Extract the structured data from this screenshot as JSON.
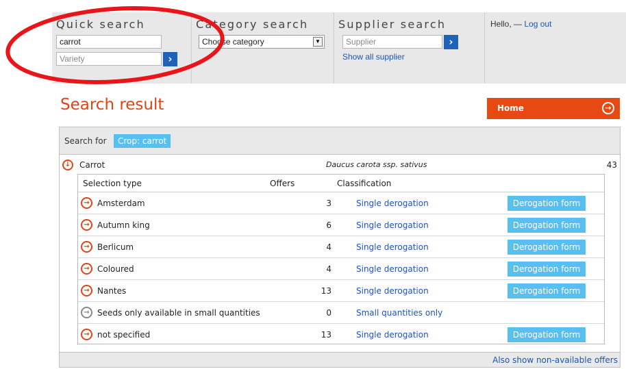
{
  "quick_search": {
    "title": "Quick search",
    "crop_value": "carrot",
    "variety_placeholder": "Variety",
    "go_label": "›"
  },
  "category_search": {
    "title": "Category search",
    "selected": "Choose category"
  },
  "supplier_search": {
    "title": "Supplier search",
    "placeholder": "Supplier",
    "go_label": "›",
    "show_all": "Show all supplier"
  },
  "user": {
    "hello": "Hello, —",
    "logout": "Log out"
  },
  "page": {
    "title": "Search result",
    "home_label": "Home"
  },
  "search_for": {
    "label": "Search for",
    "chip": "Crop: carrot"
  },
  "crop": {
    "name": "Carrot",
    "latin": "Daucus carota ssp. sativus",
    "count": "43"
  },
  "table": {
    "headers": {
      "selection": "Selection type",
      "offers": "Offers",
      "classification": "Classification"
    },
    "rows": [
      {
        "name": "Amsterdam",
        "offers": "3",
        "classification": "Single derogation",
        "form": "Derogation form",
        "icon": "orange"
      },
      {
        "name": "Autumn king",
        "offers": "6",
        "classification": "Single derogation",
        "form": "Derogation form",
        "icon": "orange"
      },
      {
        "name": "Berlicum",
        "offers": "4",
        "classification": "Single derogation",
        "form": "Derogation form",
        "icon": "orange"
      },
      {
        "name": "Coloured",
        "offers": "4",
        "classification": "Single derogation",
        "form": "Derogation form",
        "icon": "orange"
      },
      {
        "name": "Nantes",
        "offers": "13",
        "classification": "Single derogation",
        "form": "Derogation form",
        "icon": "orange"
      },
      {
        "name": "Seeds only available in small quantities",
        "offers": "0",
        "classification": "Small quantities only",
        "form": "",
        "icon": "grey"
      },
      {
        "name": "not specified",
        "offers": "13",
        "classification": "Single derogation",
        "form": "Derogation form",
        "icon": "orange"
      }
    ]
  },
  "footer": {
    "link": "Also show non-available offers"
  },
  "colors": {
    "accent": "#e04414",
    "home_bg": "#e64a12",
    "chip": "#58c0f0",
    "link": "#1a56b4",
    "go_button": "#1f63b8",
    "annotation": "#e8161a"
  }
}
